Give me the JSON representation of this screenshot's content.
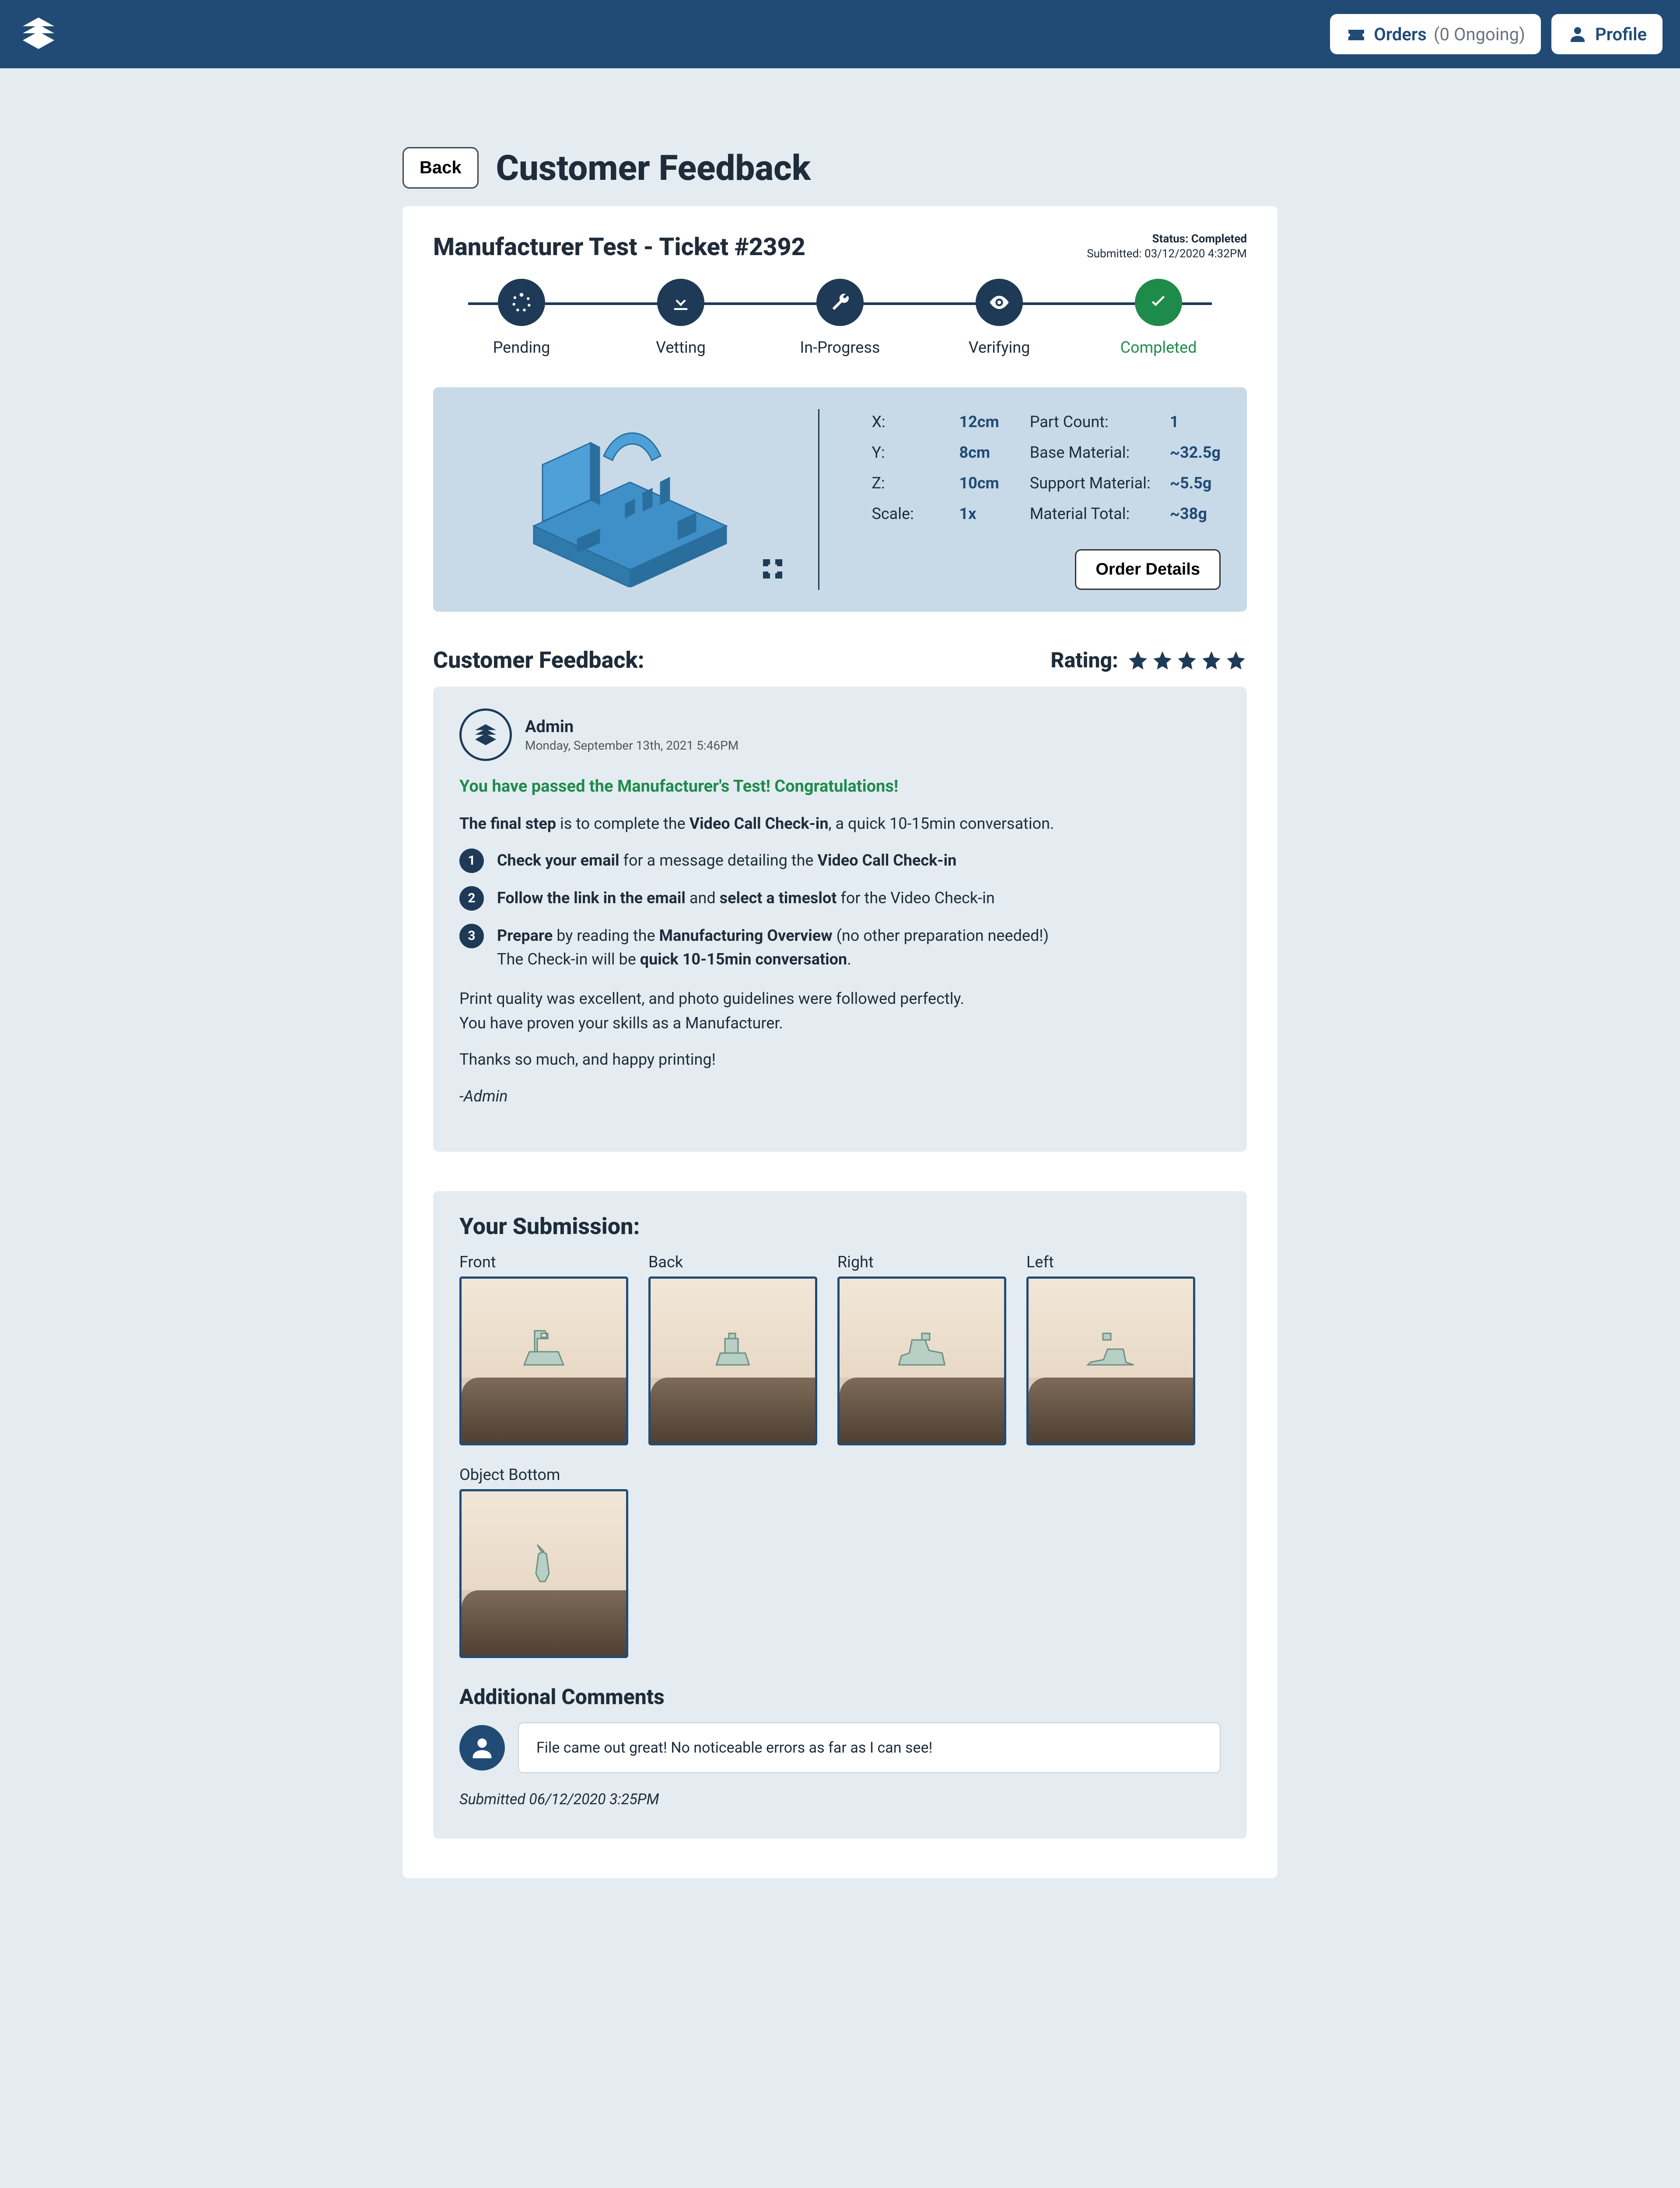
{
  "header": {
    "orders_label": "Orders",
    "orders_count": "(0 Ongoing)",
    "profile_label": "Profile"
  },
  "page": {
    "back": "Back",
    "title": "Customer Feedback"
  },
  "ticket": {
    "title": "Manufacturer Test - Ticket #2392",
    "status_label": "Status:",
    "status_value": "Completed",
    "submitted_label": "Submitted:",
    "submitted_value": "03/12/2020 4:32PM"
  },
  "progress": {
    "steps": [
      "Pending",
      "Vetting",
      "In-Progress",
      "Verifying",
      "Completed"
    ]
  },
  "specs": {
    "left": {
      "X": "12cm",
      "Y": "8cm",
      "Z": "10cm",
      "Scale": "1x"
    },
    "right": {
      "Part Count": "1",
      "Base Material": "~32.5g",
      "Support Material": "~5.5g",
      "Material Total": "~38g"
    },
    "order_details": "Order Details"
  },
  "feedback": {
    "heading": "Customer Feedback:",
    "rating_label": "Rating:",
    "stars": 5,
    "author_name": "Admin",
    "author_date": "Monday, September 13th, 2021 5:46PM",
    "pass_msg": "You have passed the Manufacturer's Test! Congratulations!",
    "intro_1": "The final step",
    "intro_2": " is to complete the ",
    "intro_3": "Video Call Check-in",
    "intro_4": ", a quick 10-15min conversation.",
    "step1_a": "Check your email",
    "step1_b": " for a message detailing the ",
    "step1_c": "Video Call Check-in",
    "step2_a": "Follow the link in the email",
    "step2_b": " and ",
    "step2_c": "select a timeslot",
    "step2_d": " for the Video Check-in",
    "step3_a": "Prepare",
    "step3_b": " by reading the ",
    "step3_c": "Manufacturing Overview",
    "step3_d": " (no other preparation needed!)",
    "step3_e": "The Check-in will be ",
    "step3_f": "quick 10-15min conversation",
    "step3_g": ".",
    "body1": "Print quality was excellent, and photo guidelines were followed perfectly.",
    "body2": "You have proven your skills as a Manufacturer.",
    "body3": "Thanks so much, and happy printing!",
    "signoff": "-Admin"
  },
  "submission": {
    "heading": "Your Submission:",
    "thumbs": [
      "Front",
      "Back",
      "Right",
      "Left",
      "Object Bottom"
    ],
    "addc_title": "Additional Comments",
    "comment": "File came out great! No noticeable errors as far as I can see!",
    "submitted_label": "Submitted",
    "submitted_value": "06/12/2020 3:25PM"
  }
}
